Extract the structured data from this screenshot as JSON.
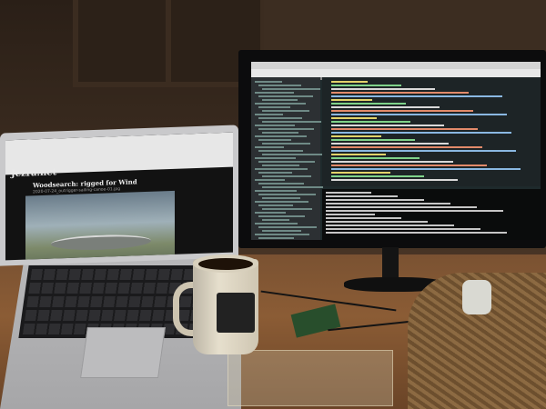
{
  "laptop": {
    "site_title": "Jezra.net",
    "post_title": "Woodsearch: rigged for Wind",
    "caption": "2020-07-24_outrigger-sailing-canoe-01.jpg"
  }
}
